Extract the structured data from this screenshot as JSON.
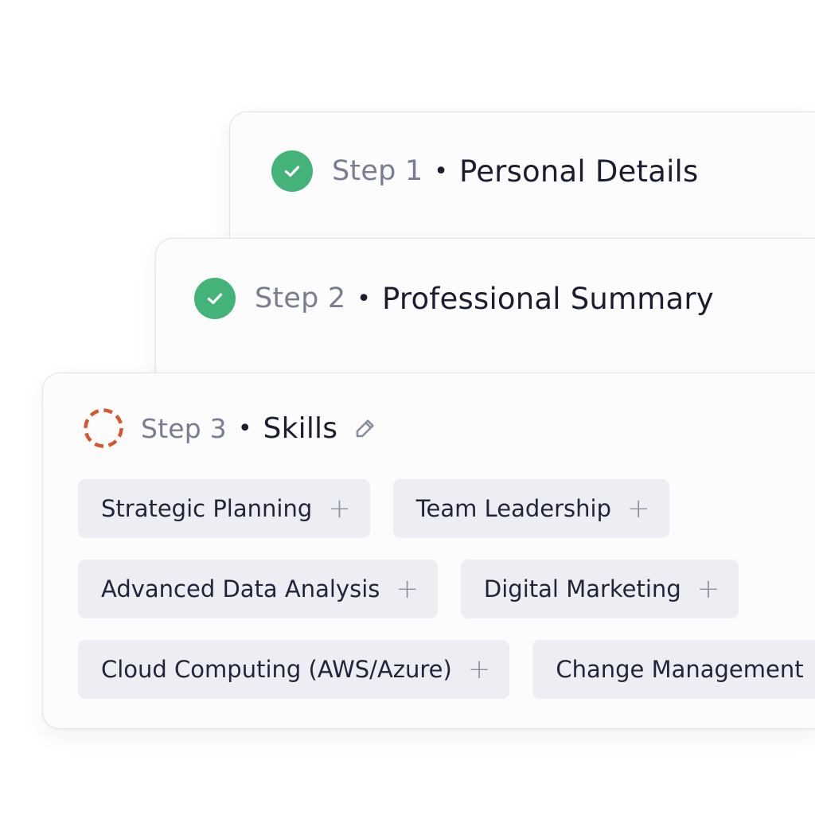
{
  "steps": [
    {
      "label": "Step 1",
      "title": "Personal Details",
      "status": "complete"
    },
    {
      "label": "Step 2",
      "title": "Professional Summary",
      "status": "complete"
    },
    {
      "label": "Step 3",
      "title": "Skills",
      "status": "in-progress"
    }
  ],
  "separator": "•",
  "skills": [
    "Strategic Planning",
    "Team Leadership",
    "Advanced Data Analysis",
    "Digital Marketing",
    "Cloud Computing (AWS/Azure)",
    "Change Management"
  ],
  "icons": {
    "complete": "check-circle-icon",
    "in_progress": "dashed-circle-icon",
    "edit": "pencil-icon",
    "add": "plus-icon"
  },
  "add_glyph": "+",
  "colors": {
    "complete_green": "#44b37a",
    "in_progress_orange": "#d4572e",
    "chip_bg": "#eceef4",
    "muted_text": "#787d92",
    "primary_text": "#1b1e2e"
  }
}
